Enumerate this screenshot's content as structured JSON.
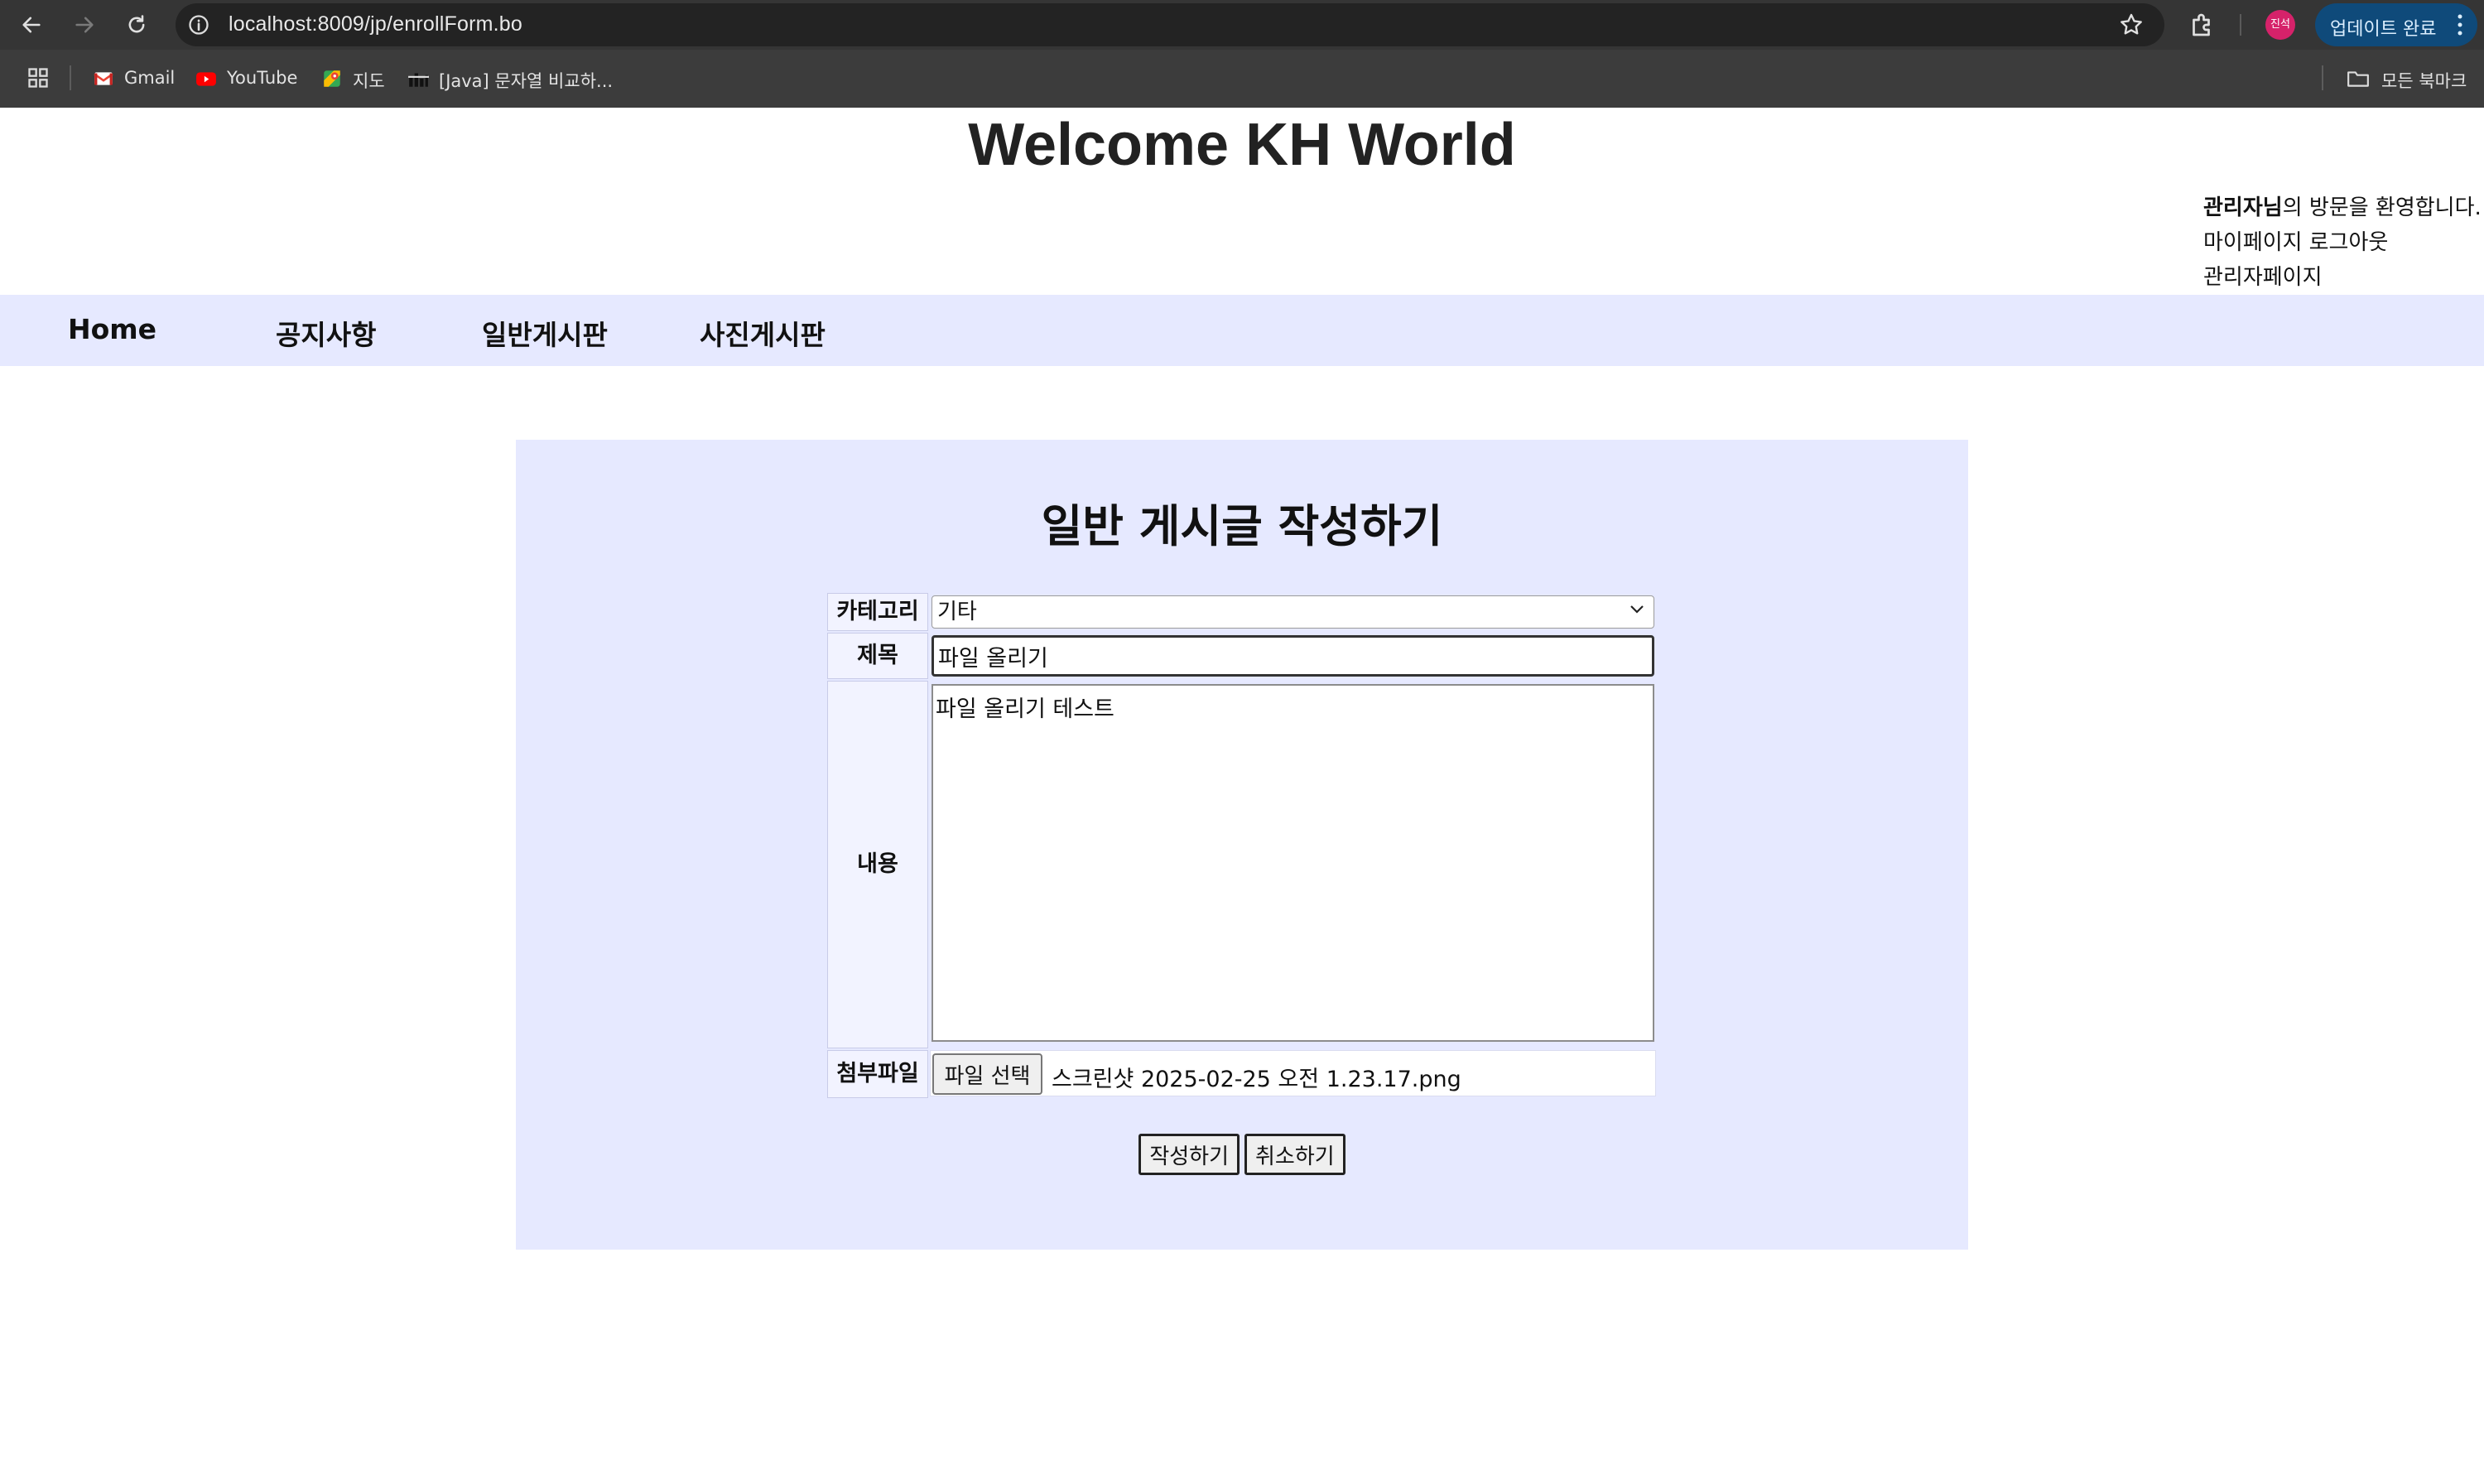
{
  "browser": {
    "url": "localhost:8009/jp/enrollForm.bo",
    "profile_initials": "진석",
    "update_label": "업데이트 완료",
    "bookmarks": [
      {
        "label": "Gmail",
        "icon": "gmail-icon"
      },
      {
        "label": "YouTube",
        "icon": "youtube-icon"
      },
      {
        "label": "지도",
        "icon": "maps-icon"
      },
      {
        "label": "[Java] 문자열 비교하...",
        "icon": "tistory-icon"
      }
    ],
    "all_bookmarks_label": "모든 북마크"
  },
  "header": {
    "title": "Welcome KH World",
    "user_name": "관리자님",
    "welcome_suffix": "의 방문을 환영합니다.",
    "mypage_label": "마이페이지",
    "logout_label": "로그아웃",
    "admin_label": "관리자페이지"
  },
  "nav": {
    "items": [
      "Home",
      "공지사항",
      "일반게시판",
      "사진게시판"
    ]
  },
  "form": {
    "heading": "일반 게시글 작성하기",
    "category_label": "카테고리",
    "category_value": "기타",
    "title_label": "제목",
    "title_value": "파일 올리기",
    "content_label": "내용",
    "content_value": "파일 올리기 테스트",
    "file_label": "첨부파일",
    "file_button": "파일 선택",
    "file_name": "스크린샷 2025-02-25 오전 1.23.17.png",
    "submit_label": "작성하기",
    "cancel_label": "취소하기"
  },
  "colors": {
    "nav_bg": "#e6e9ff",
    "panel_bg": "#e6e9ff",
    "chrome_bg": "#3c3c3c",
    "update_btn": "#0f4a7a"
  }
}
